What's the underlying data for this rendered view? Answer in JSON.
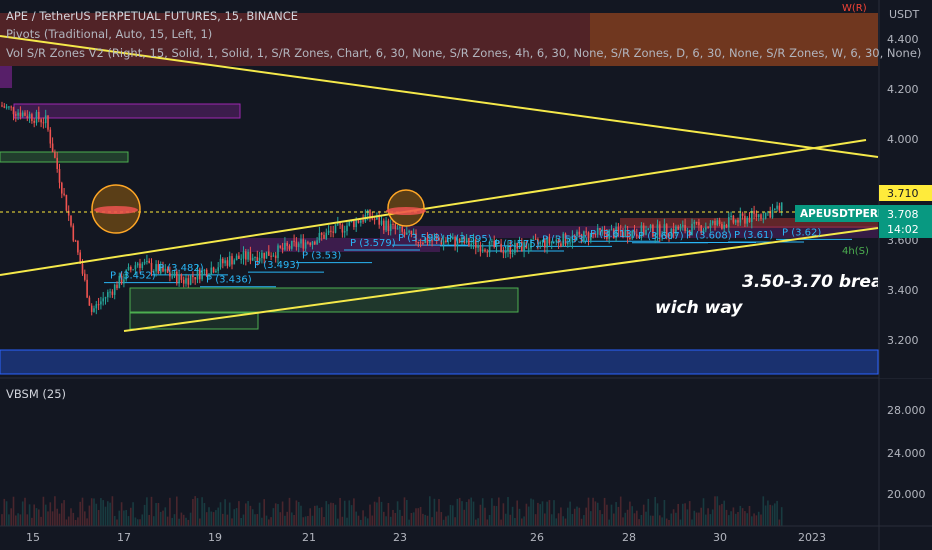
{
  "header": {
    "symbol_line": "APE / TetherUS PERPETUAL FUTURES, 15, BINANCE",
    "pivots_line": "Pivots (Traditional, Auto, 15, Left, 1)",
    "vol_line": "Vol S/R Zones V2 (Right, 15, Solid, 1, Solid, 1, S/R Zones, Chart, 6, 30, None, S/R Zones, 4h, 6, 30, None, S/R Zones, D, 6, 30, None, S/R Zones, W, 6, 30, None)"
  },
  "axis": {
    "currency": "USDT",
    "price_ticks": [
      "4.400",
      "4.200",
      "4.000",
      "3.600",
      "3.400",
      "3.200"
    ],
    "volume_ticks": [
      "28.000",
      "24.000",
      "20.000"
    ],
    "date_ticks": [
      "15",
      "17",
      "19",
      "21",
      "23",
      "26",
      "28",
      "30",
      "2023"
    ],
    "last_price_label": "3.710",
    "symbol_tag": "APEUSDTPERP",
    "current_price": "3.708",
    "countdown": "14:02",
    "zone_label_4h": "4h(S)",
    "zone_label_w": "W(R)"
  },
  "indicator": {
    "label": "VBSM (25)"
  },
  "annotations": {
    "breakout_text": "3.50-3.70 break",
    "direction_text": "wich way"
  },
  "pivot_labels": [
    "P (3.452)",
    "P (3.482)",
    "P (3.436)",
    "P (3.493)",
    "P (3.53)",
    "P (3.579)",
    "P (3.598)",
    "P (3.595)",
    "P (3.575)",
    "P (3.593)",
    "P (3.613)",
    "P (3.607)",
    "P (3.608)",
    "P (3.61)",
    "P (3.62)"
  ],
  "colors": {
    "background": "#131722",
    "up": "#26a69a",
    "down": "#ef5350",
    "trendline": "#f5e94a",
    "support_zone": "#4caf50",
    "resistance_zone": "#f44336",
    "pivot_zone": "#9c27b0",
    "tag_green": "#089981",
    "price_yellow": "#ffeb3b",
    "pivot_label": "#29b6f6"
  },
  "chart_data": {
    "type": "line",
    "title": "APE / TetherUS PERPETUAL FUTURES, 15, BINANCE",
    "x": [
      "15",
      "16",
      "17",
      "18",
      "19",
      "20",
      "21",
      "22",
      "23",
      "24",
      "25",
      "26",
      "27",
      "28",
      "29",
      "30",
      "31",
      "2023"
    ],
    "series": [
      {
        "name": "",
        "values": [
          4.11,
          4.05,
          3.31,
          3.5,
          3.43,
          3.51,
          3.54,
          3.6,
          3.68,
          3.59,
          3.58,
          3.55,
          3.58,
          3.61,
          3.62,
          3.63,
          3.66,
          3.708
        ]
      }
    ],
    "ylim": [
      3.05,
      4.52
    ],
    "grid": false,
    "last_price": 3.708
  }
}
